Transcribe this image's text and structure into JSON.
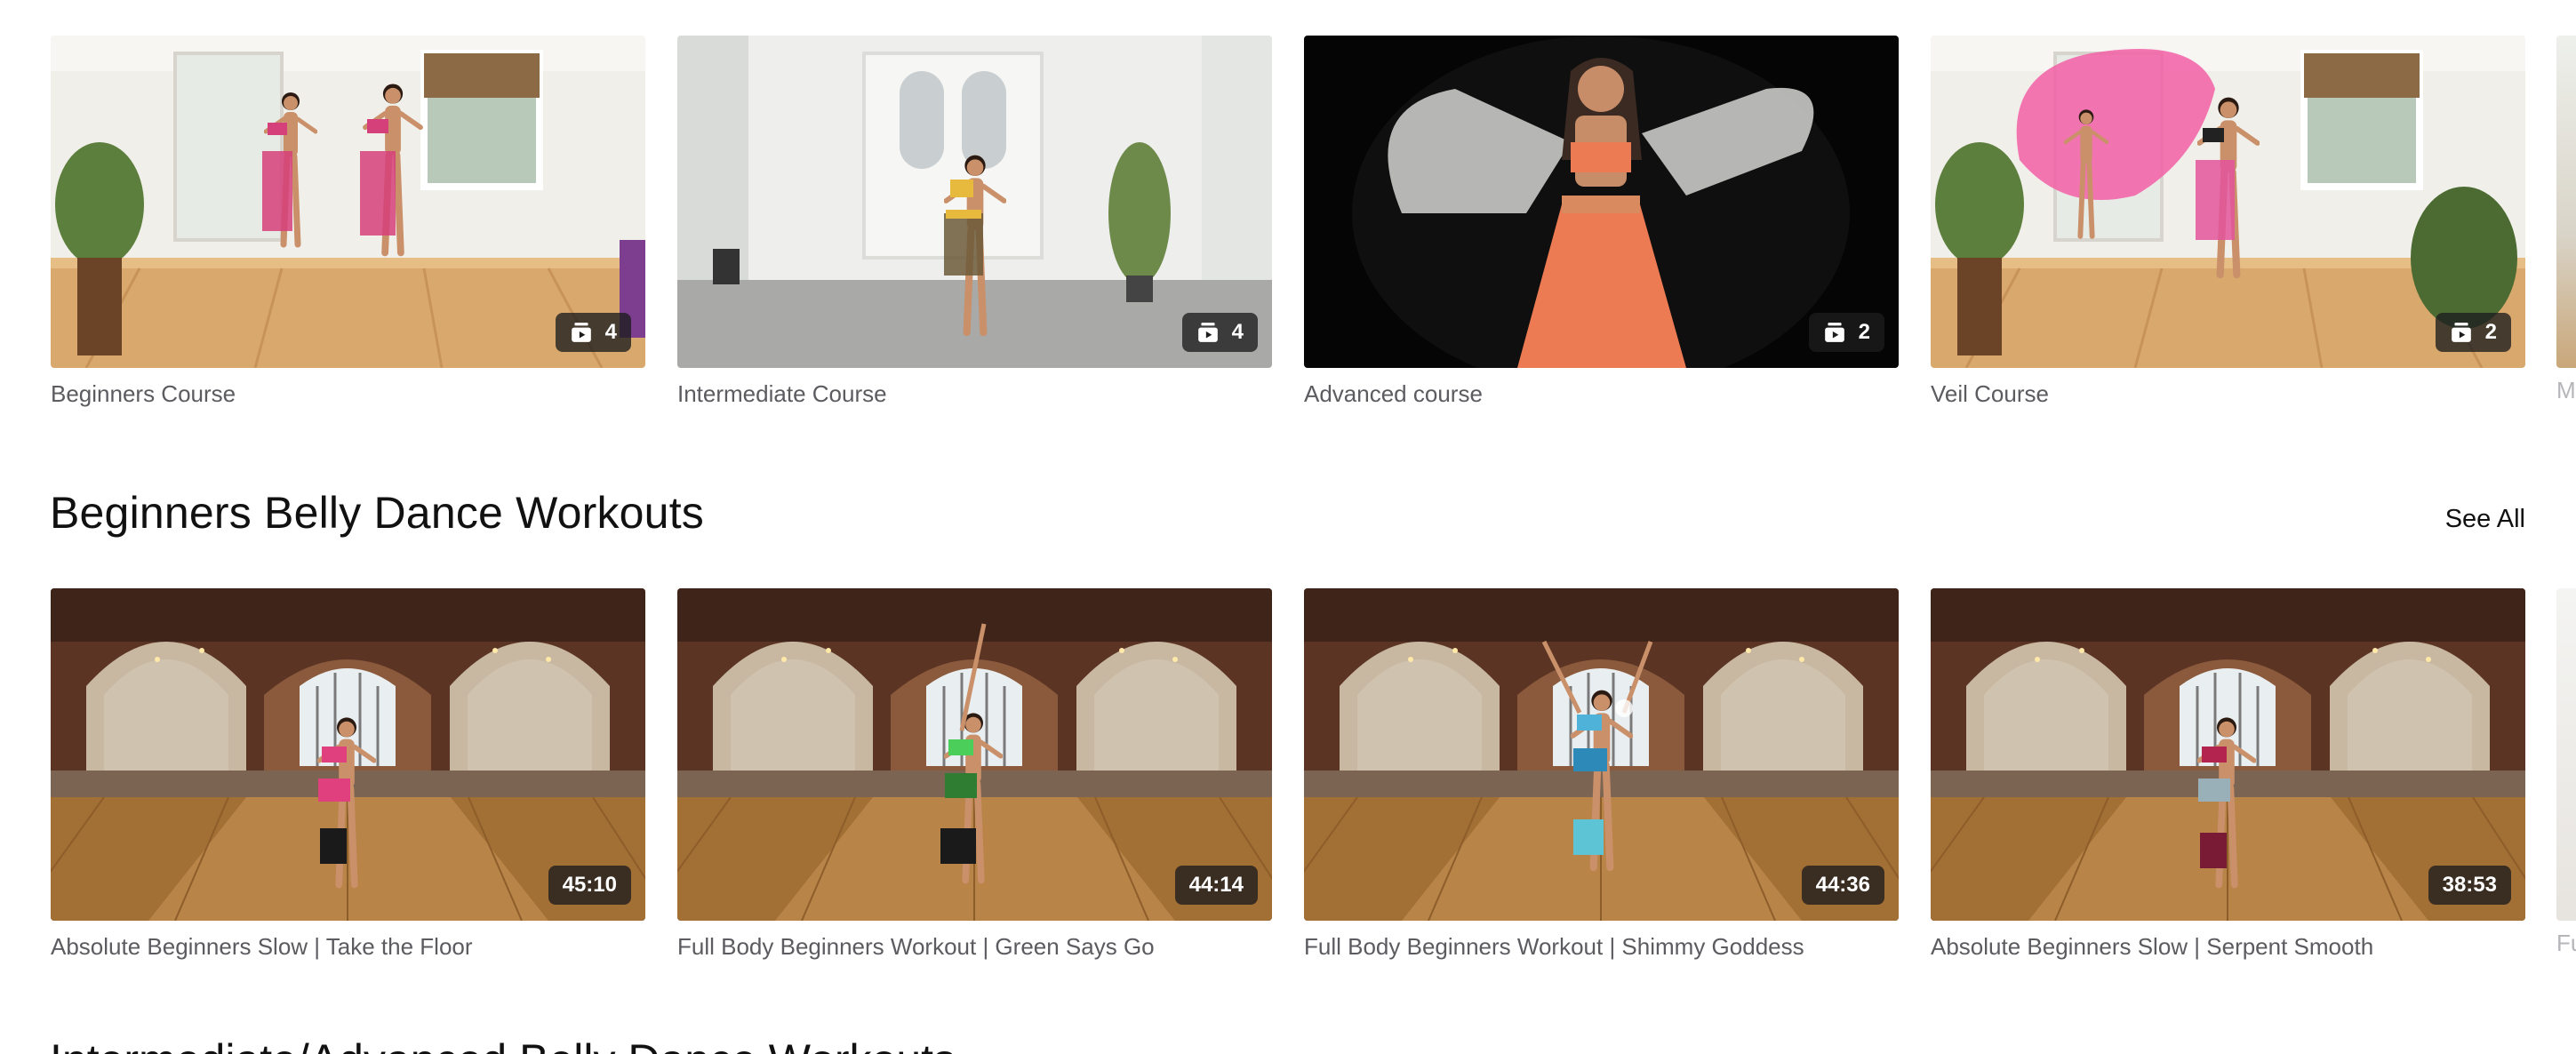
{
  "courses": [
    {
      "title": "Beginners Course",
      "count": "4"
    },
    {
      "title": "Intermediate Course",
      "count": "4"
    },
    {
      "title": "Advanced course",
      "count": "2"
    },
    {
      "title": "Veil Course",
      "count": "2"
    }
  ],
  "courses_peek_label": "M",
  "section": {
    "title": "Beginners Belly Dance Workouts",
    "see_all": "See All"
  },
  "workouts": [
    {
      "title": "Absolute Beginners Slow | Take the Floor",
      "duration": "45:10"
    },
    {
      "title": "Full Body Beginners Workout | Green Says Go",
      "duration": "44:14"
    },
    {
      "title": "Full Body Beginners Workout | Shimmy Goddess",
      "duration": "44:36"
    },
    {
      "title": "Absolute Beginners Slow | Serpent Smooth",
      "duration": "38:53"
    }
  ],
  "workouts_peek_label": "Fu",
  "next_section": {
    "title": "Intermediate/Advanced Belly Dance Workouts"
  },
  "icons": {
    "course_badge": "stacked-videos-icon"
  }
}
